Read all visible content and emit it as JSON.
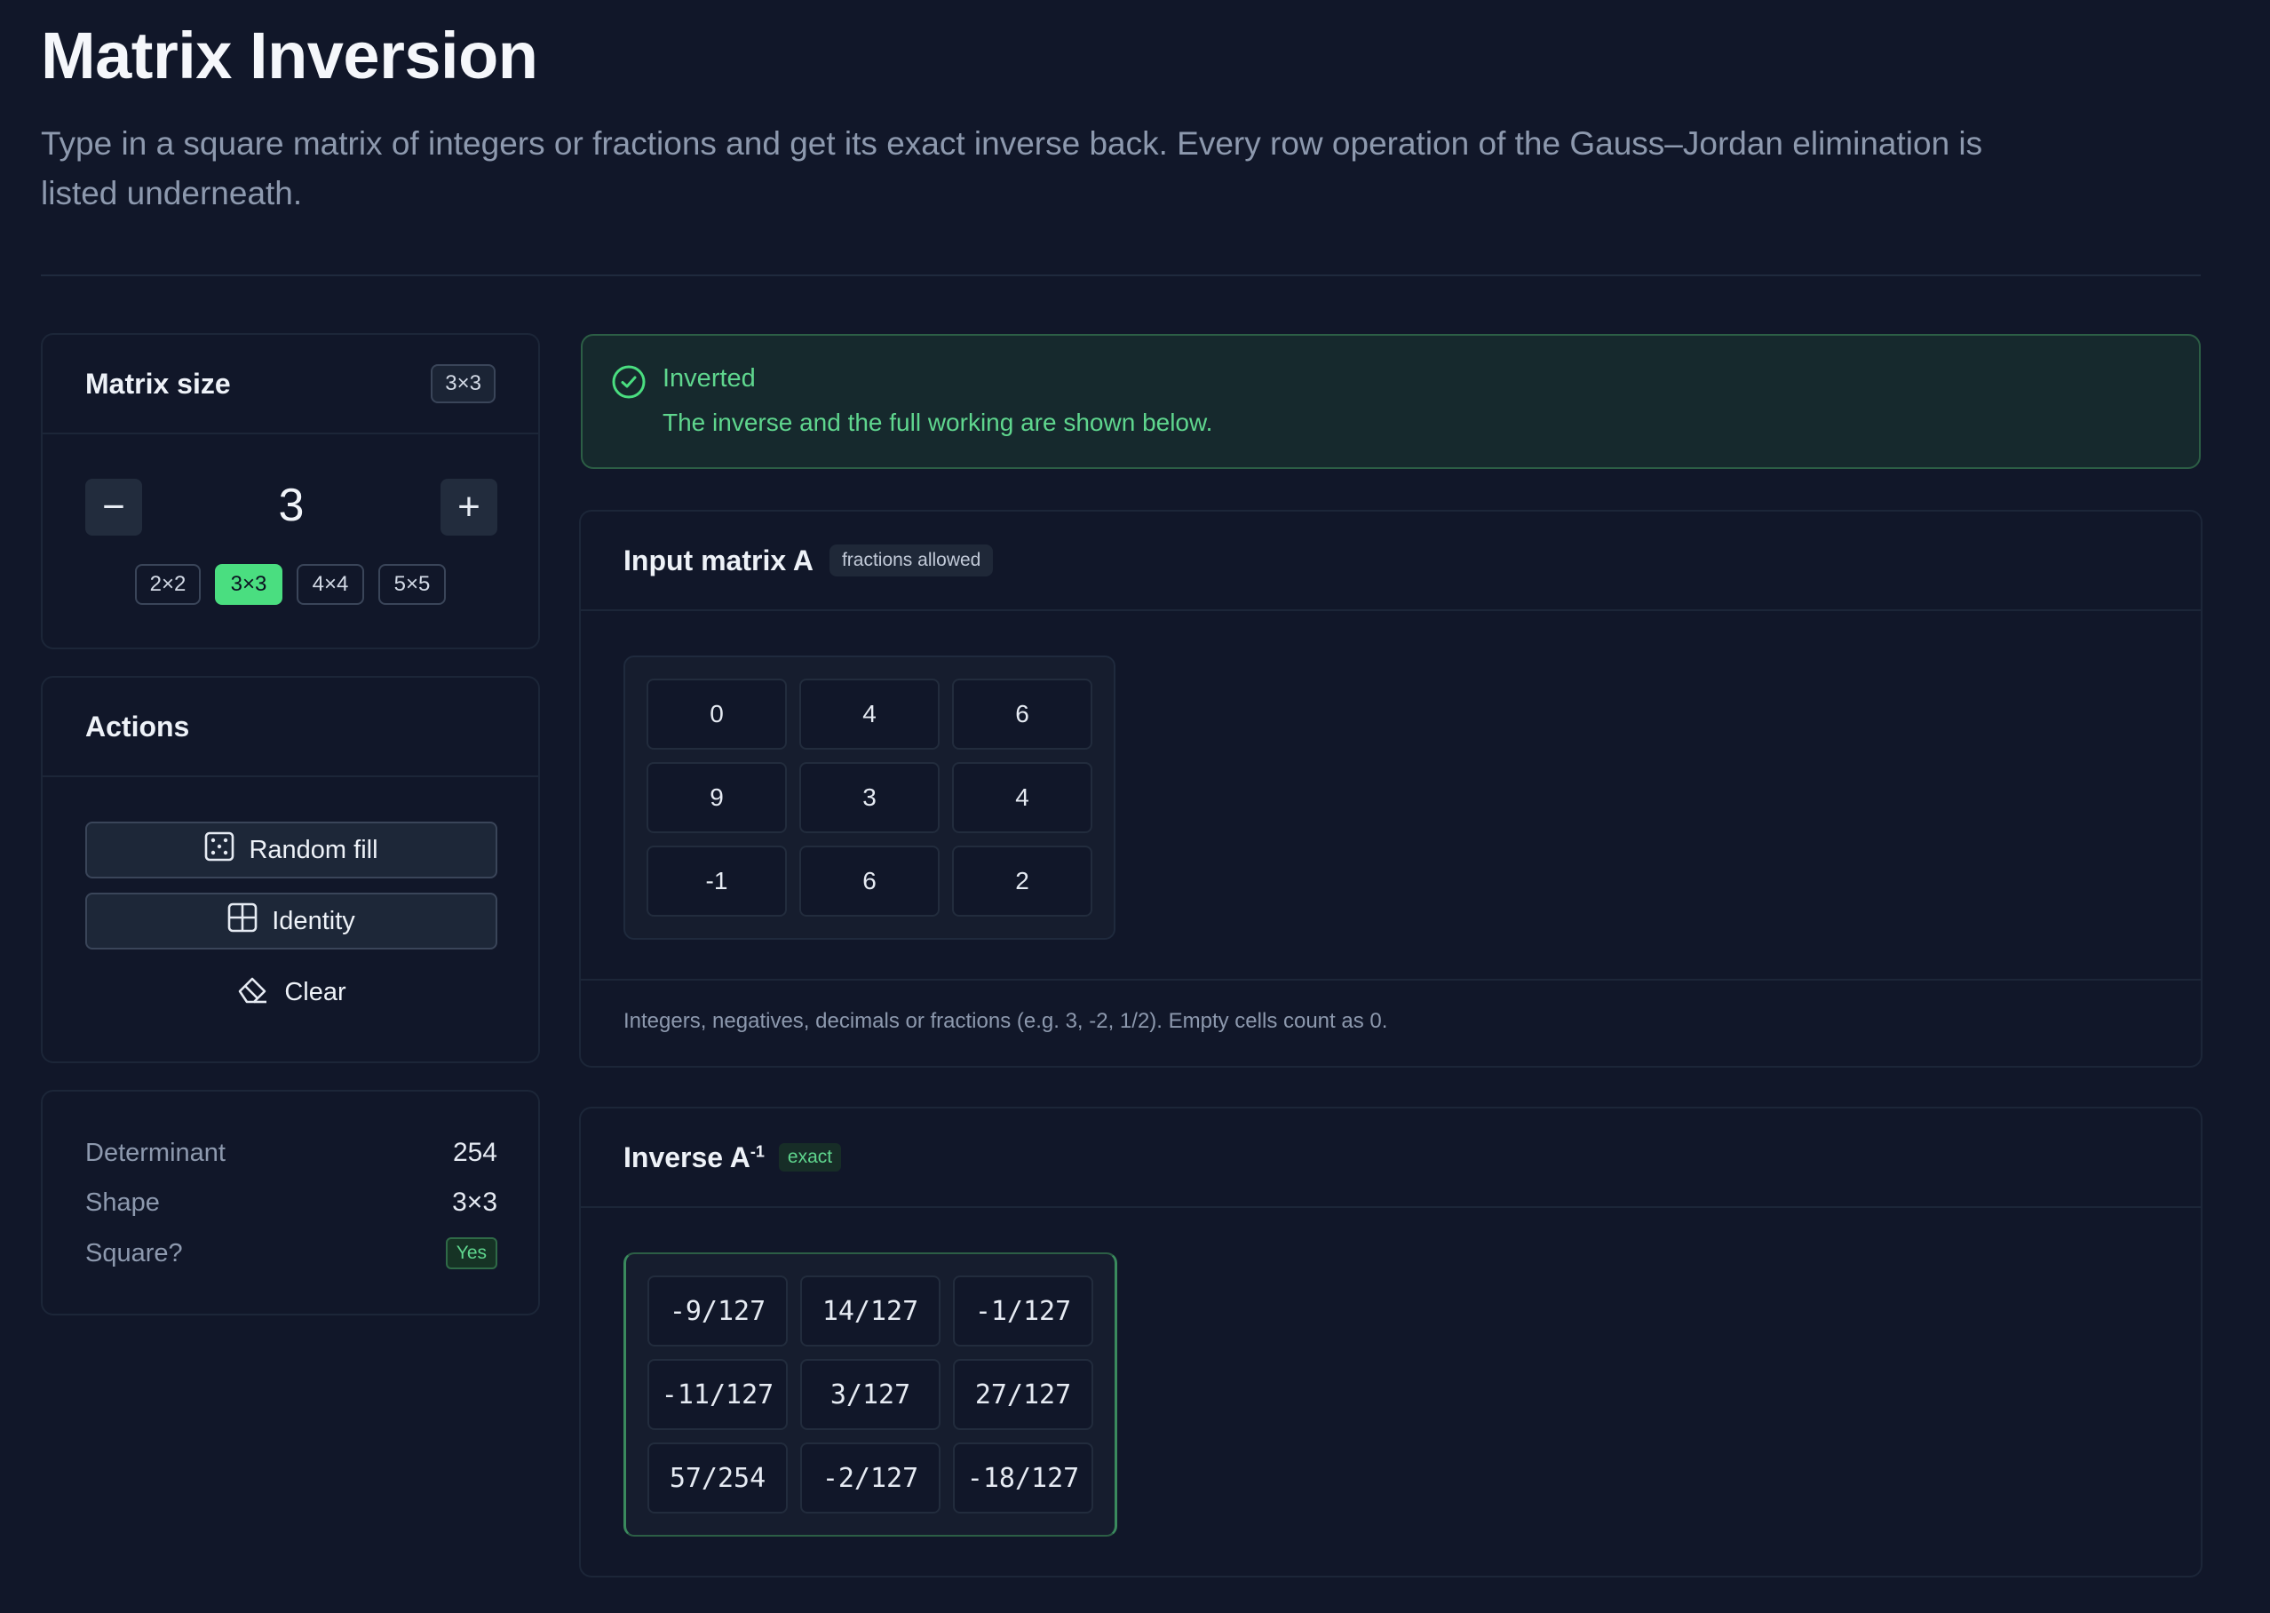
{
  "header": {
    "title": "Matrix Inversion",
    "subtitle": "Type in a square matrix of integers or fractions and get its exact inverse back. Every row operation of the Gauss–Jordan elimination is listed underneath."
  },
  "size_card": {
    "title": "Matrix size",
    "badge": "3×3",
    "minus_symbol": "−",
    "plus_symbol": "+",
    "value": "3",
    "presets": [
      {
        "label": "2×2",
        "active": false
      },
      {
        "label": "3×3",
        "active": true
      },
      {
        "label": "4×4",
        "active": false
      },
      {
        "label": "5×5",
        "active": false
      }
    ]
  },
  "actions_card": {
    "title": "Actions",
    "random_fill": "Random fill",
    "identity": "Identity",
    "clear": "Clear"
  },
  "stats_card": {
    "determinant_label": "Determinant",
    "determinant_value": "254",
    "shape_label": "Shape",
    "shape_value": "3×3",
    "square_label": "Square?",
    "square_value": "Yes"
  },
  "status": {
    "title": "Inverted",
    "message": "The inverse and the full working are shown below.",
    "color": "#4ade80"
  },
  "input_card": {
    "title": "Input matrix A",
    "badge": "fractions allowed",
    "rows": [
      [
        "0",
        "4",
        "6"
      ],
      [
        "9",
        "3",
        "4"
      ],
      [
        "-1",
        "6",
        "2"
      ]
    ],
    "hint": "Integers, negatives, decimals or fractions (e.g. 3, -2, 1/2). Empty cells count as 0."
  },
  "inverse_card": {
    "title": "Inverse A",
    "superscript": "-1",
    "badge": "exact",
    "rows": [
      [
        "-9/127",
        "14/127",
        "-1/127"
      ],
      [
        "-11/127",
        "3/127",
        "27/127"
      ],
      [
        "57/254",
        "-2/127",
        "-18/127"
      ]
    ]
  }
}
